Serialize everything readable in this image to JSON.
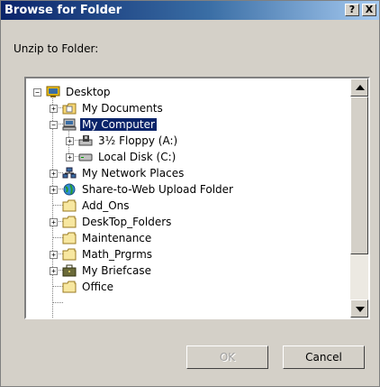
{
  "window": {
    "title": "Browse for Folder",
    "help_button": "?",
    "close_button": "X"
  },
  "prompt": "Unzip to Folder:",
  "tree": {
    "items": [
      {
        "label": "Desktop",
        "expander": "−",
        "icon": "desktop-icon",
        "selected": false
      },
      {
        "label": "My Documents",
        "expander": "+",
        "icon": "my-documents-icon",
        "selected": false
      },
      {
        "label": "My Computer",
        "expander": "−",
        "icon": "my-computer-icon",
        "selected": true
      },
      {
        "label": "3½ Floppy (A:)",
        "expander": "+",
        "icon": "floppy-drive-icon",
        "selected": false
      },
      {
        "label": "Local Disk (C:)",
        "expander": "+",
        "icon": "hard-disk-icon",
        "selected": false
      },
      {
        "label": "My Network Places",
        "expander": "+",
        "icon": "network-places-icon",
        "selected": false
      },
      {
        "label": "Share-to-Web Upload Folder",
        "expander": "+",
        "icon": "web-folder-icon",
        "selected": false
      },
      {
        "label": "Add_Ons",
        "expander": "",
        "icon": "folder-icon",
        "selected": false
      },
      {
        "label": "DeskTop_Folders",
        "expander": "+",
        "icon": "folder-icon",
        "selected": false
      },
      {
        "label": "Maintenance",
        "expander": "",
        "icon": "folder-icon",
        "selected": false
      },
      {
        "label": "Math_Prgrms",
        "expander": "+",
        "icon": "folder-icon",
        "selected": false
      },
      {
        "label": "My Briefcase",
        "expander": "+",
        "icon": "briefcase-icon",
        "selected": false
      },
      {
        "label": "Office",
        "expander": "",
        "icon": "folder-icon",
        "selected": false
      }
    ]
  },
  "buttons": {
    "ok": "OK",
    "cancel": "Cancel"
  },
  "colors": {
    "titlebar_start": "#0a246a",
    "titlebar_end": "#a6caf0",
    "selection": "#0a246a",
    "dialog_face": "#d4d0c8"
  }
}
